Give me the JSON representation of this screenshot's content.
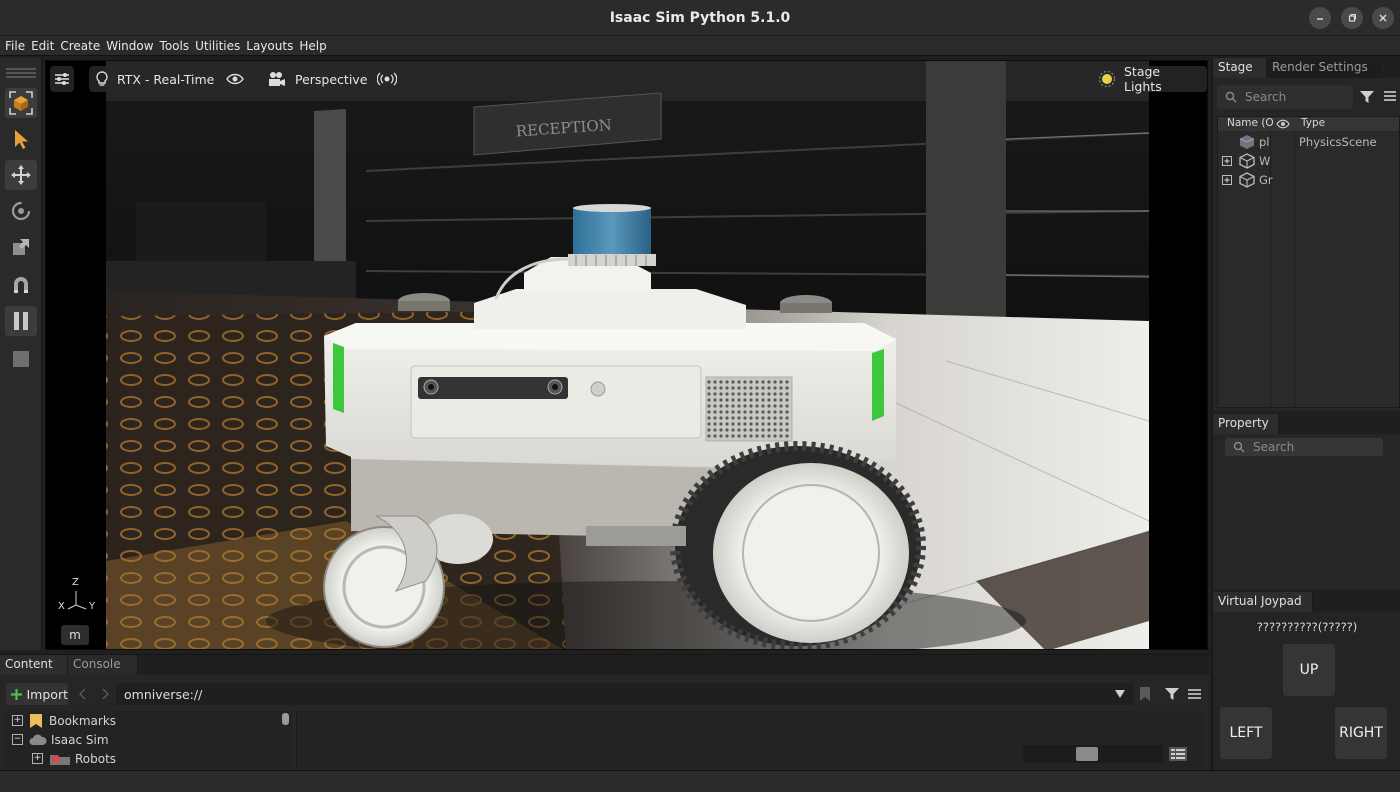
{
  "window": {
    "title": "Isaac Sim Python 5.1.0",
    "controls": [
      "minimize-icon",
      "restore-icon",
      "close-icon"
    ]
  },
  "menu": [
    "File",
    "Edit",
    "Create",
    "Window",
    "Tools",
    "Utilities",
    "Layouts",
    "Help"
  ],
  "toolbar": {
    "tools": [
      {
        "name": "select-prim-icon",
        "active": true
      },
      {
        "name": "select-arrow-icon",
        "active": false
      },
      {
        "name": "move-icon",
        "active": true
      },
      {
        "name": "rotate-icon",
        "active": false
      },
      {
        "name": "scale-icon",
        "active": false
      },
      {
        "name": "snap-magnet-icon",
        "active": false
      },
      {
        "name": "pause-icon",
        "active": true
      },
      {
        "name": "stop-icon",
        "active": false
      }
    ]
  },
  "viewport": {
    "settings_icon": "sliders-icon",
    "renderer_label": "RTX - Real-Time",
    "camera_label": "Perspective",
    "lights_label": "Stage Lights",
    "axis": {
      "z": "Z",
      "x": "X",
      "y": "Y"
    },
    "key_hint": "m",
    "scene": {
      "sign_text": "RECEPTION",
      "accent_color": "#3cc83c",
      "lidar_color": "#3a7fa6"
    }
  },
  "stage": {
    "tabs": [
      "Stage",
      "Render Settings"
    ],
    "search_placeholder": "Search",
    "columns": {
      "name": "Name (O",
      "type": "Type"
    },
    "rows": [
      {
        "name": "pl",
        "type": "PhysicsScene",
        "expandable": false
      },
      {
        "name": "W",
        "type": "",
        "expandable": true
      },
      {
        "name": "Gr",
        "type": "",
        "expandable": true
      }
    ]
  },
  "property": {
    "tab": "Property",
    "search_placeholder": "Search"
  },
  "joypad": {
    "tab": "Virtual Joypad",
    "status": "??????????(?????)",
    "up": "UP",
    "left": "LEFT",
    "right": "RIGHT"
  },
  "content": {
    "tabs": [
      "Content",
      "Console"
    ],
    "import_label": "Import",
    "path": "omniverse://",
    "tree": [
      {
        "label": "Bookmarks",
        "expander": "+"
      },
      {
        "label": "Isaac Sim",
        "expander": "−"
      },
      {
        "label": "Robots",
        "expander": "+"
      }
    ],
    "zoom_level": 0.45
  }
}
